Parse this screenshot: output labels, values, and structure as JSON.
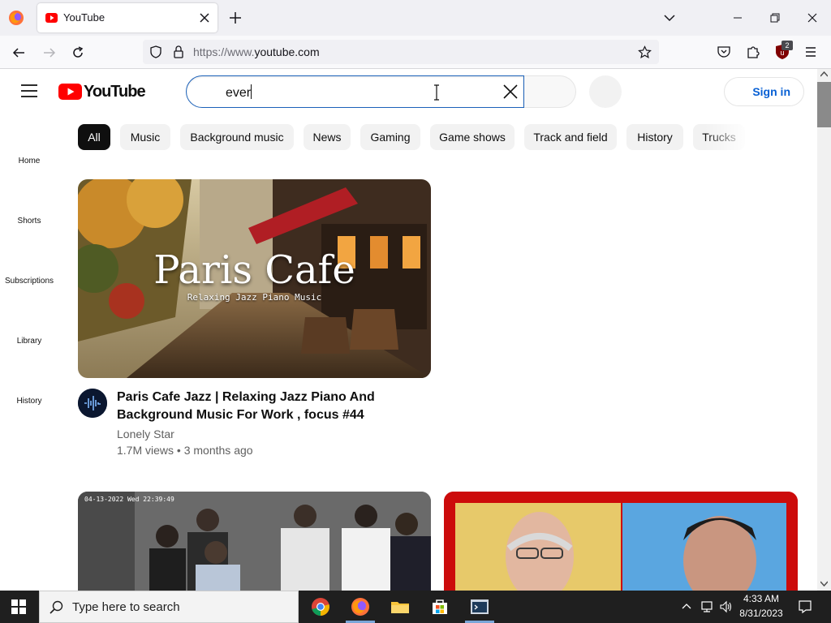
{
  "browser": {
    "tab_title": "YouTube",
    "url_prefix": "https://www.",
    "url_domain": "youtube.com",
    "extension_badge": "2"
  },
  "youtube": {
    "logo_text": "YouTube",
    "search_value": "ever",
    "signin_label": "Sign in",
    "chips": [
      "All",
      "Music",
      "Background music",
      "News",
      "Gaming",
      "Game shows",
      "Track and field",
      "History",
      "Trucks"
    ],
    "active_chip": "All",
    "sidebar": [
      {
        "label": "Home",
        "icon": "home-icon"
      },
      {
        "label": "Shorts",
        "icon": "shorts-icon"
      },
      {
        "label": "Subscriptions",
        "icon": "subscriptions-icon"
      },
      {
        "label": "Library",
        "icon": "library-icon"
      },
      {
        "label": "History",
        "icon": "history-icon"
      }
    ],
    "videos": [
      {
        "thumb_title": "Paris Cafe",
        "thumb_subtitle": "Relaxing Jazz Piano Music",
        "title": "Paris Cafe Jazz | Relaxing Jazz Piano And Background Music For Work , focus #44",
        "channel": "Lonely Star",
        "views": "1.7M views",
        "age": "3 months ago"
      },
      {
        "thumb_timestamp": "04-13-2022  Wed 22:39:49"
      },
      {}
    ],
    "brand_red": "#ff0000"
  },
  "taskbar": {
    "search_placeholder": "Type here to search",
    "time": "4:33 AM",
    "date": "8/31/2023"
  }
}
